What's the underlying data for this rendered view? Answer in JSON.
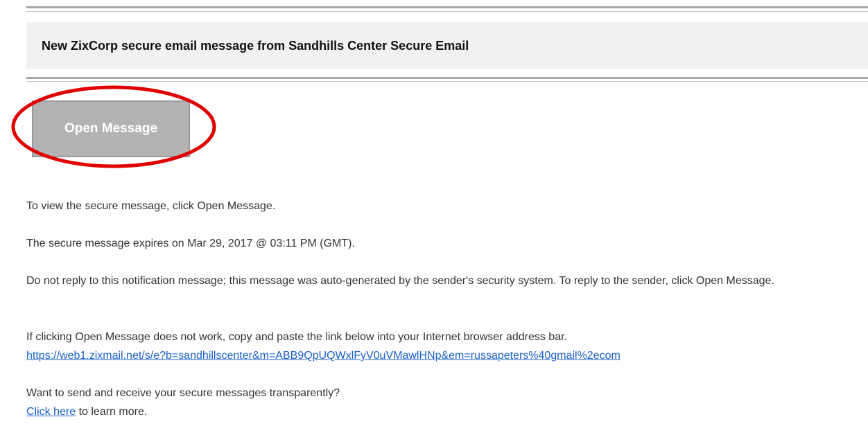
{
  "header": {
    "title": "New ZixCorp secure email message from Sandhills Center Secure Email"
  },
  "open_button": {
    "label": "Open Message"
  },
  "paragraphs": {
    "view": "To view the secure message, click Open Message.",
    "expires": "The secure message expires on Mar 29, 2017 @ 03:11 PM (GMT).",
    "no_reply": "Do not reply to this notification message; this message was auto-generated by the sender's security system. To reply to the sender, click Open Message.",
    "copy_link": "If clicking Open Message does not work, copy and paste the link below into your Internet browser address bar.",
    "link_url": "https://web1.zixmail.net/s/e?b=sandhillscenter&m=ABB9QpUQWxlFyV0uVMawlHNp&em=russapeters%40gmail%2ecom",
    "transparent": "Want to send and receive your secure messages transparently?",
    "click_here": "Click here",
    "learn_more": " to learn more."
  },
  "colors": {
    "link": "#1a5fc8",
    "highlight_ellipse": "#e00000",
    "button_bg": "#b3b3b3",
    "header_bg": "#f1f1f1"
  }
}
